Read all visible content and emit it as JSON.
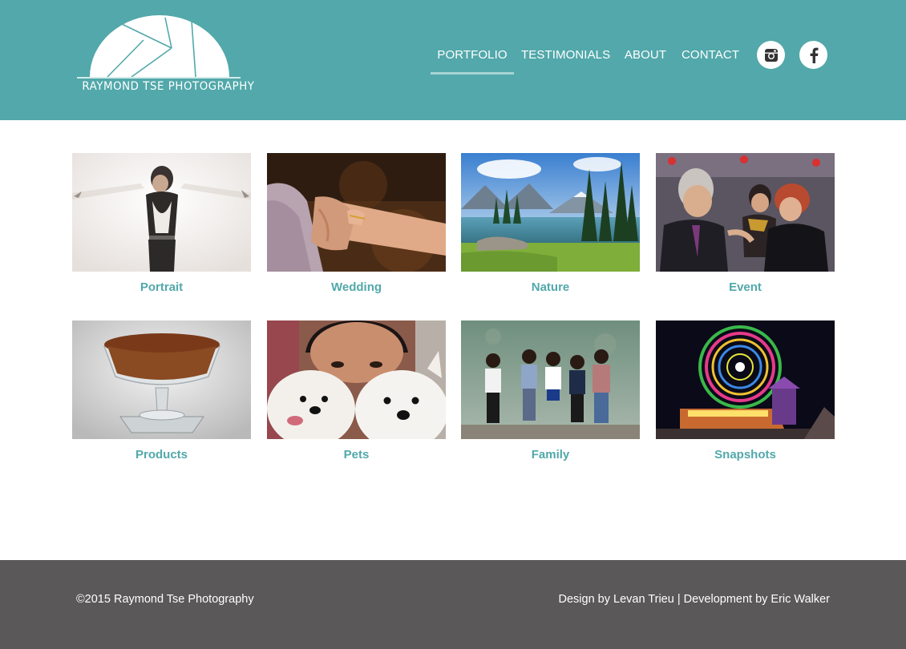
{
  "brand": {
    "logo_text": "RAYMOND TSE PHOTOGRAPHY",
    "color_header": "#52a8aa",
    "color_accent": "#52a8aa",
    "color_footer": "#5a5858"
  },
  "nav": {
    "items": [
      {
        "label": "PORTFOLIO",
        "active": true
      },
      {
        "label": "TESTIMONIALS",
        "active": false
      },
      {
        "label": "ABOUT",
        "active": false
      },
      {
        "label": "CONTACT",
        "active": false
      }
    ],
    "social": [
      {
        "icon": "instagram-icon"
      },
      {
        "icon": "facebook-icon"
      }
    ]
  },
  "portfolio": {
    "categories": [
      {
        "label": "Portrait",
        "photo": "portrait-photo"
      },
      {
        "label": "Wedding",
        "photo": "wedding-photo"
      },
      {
        "label": "Nature",
        "photo": "nature-photo"
      },
      {
        "label": "Event",
        "photo": "event-photo"
      },
      {
        "label": "Products",
        "photo": "products-photo"
      },
      {
        "label": "Pets",
        "photo": "pets-photo"
      },
      {
        "label": "Family",
        "photo": "family-photo"
      },
      {
        "label": "Snapshots",
        "photo": "snapshots-photo"
      }
    ]
  },
  "footer": {
    "copyright": "©2015 Raymond Tse Photography",
    "credits": "Design by Levan Trieu | Development by Eric Walker"
  }
}
